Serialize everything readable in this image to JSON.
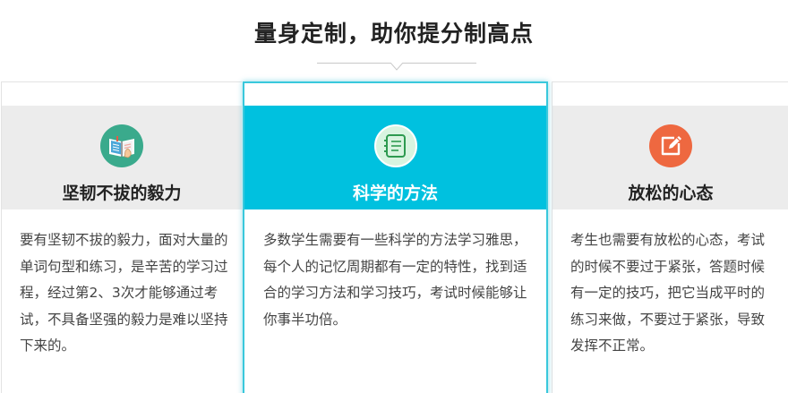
{
  "section": {
    "title": "量身定制，助你提分制高点"
  },
  "cards": [
    {
      "title": "坚韧不拔的毅力",
      "icon": "open-book-hand-icon",
      "text": "要有坚韧不拔的毅力，面对大量的单词句型和练习，是辛苦的学习过程，经过第2、3次才能够通过考试，不具备坚强的毅力是难以坚持下来的。"
    },
    {
      "title": "科学的方法",
      "icon": "notebook-icon",
      "text": "多数学生需要有一些科学的方法学习雅思，每个人的记忆周期都有一定的特性，找到适合的学习方法和学习技巧，考试时候能够让你事半功倍。"
    },
    {
      "title": "放松的心态",
      "icon": "edit-pencil-icon",
      "text": "考生也需要有放松的心态，考试的时候不要过于紧张，答题时候有一定的技巧，把它当成平时的练习来做，不要过于紧张，导致发挥不正常。"
    }
  ],
  "colors": {
    "accent": "#00c1df",
    "card1_icon": "#3aaa8c",
    "card3_icon": "#ee6840",
    "inactive_header": "#ececec"
  }
}
